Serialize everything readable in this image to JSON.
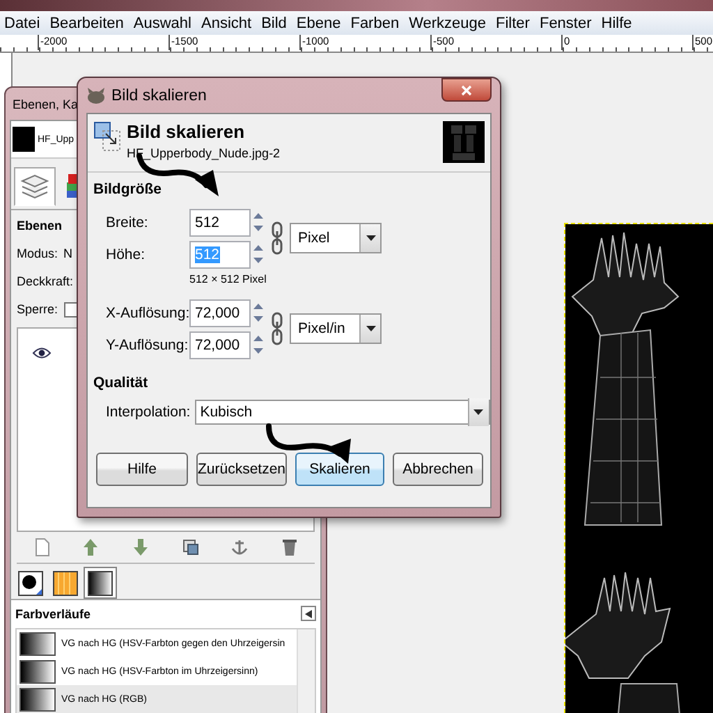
{
  "image_window": {
    "menu": [
      "Datei",
      "Bearbeiten",
      "Auswahl",
      "Ansicht",
      "Bild",
      "Ebene",
      "Farben",
      "Werkzeuge",
      "Filter",
      "Fenster",
      "Hilfe"
    ],
    "ruler_labels": [
      "-2000",
      "-1500",
      "-1000",
      "-500",
      "0",
      "500"
    ]
  },
  "dock": {
    "title": "Ebenen, Ka",
    "image": {
      "name": "HF_Upp"
    },
    "tabs": [
      {
        "kind": "layers",
        "selected": true
      },
      {
        "kind": "channels",
        "selected": false
      }
    ],
    "layers": {
      "title": "Ebenen",
      "mode_label": "Modus:",
      "mode_value": "N",
      "opacity_label": "Deckkraft:",
      "lock_label": "Sperre:",
      "lock_checked": false,
      "items": [
        {
          "visible": true
        }
      ]
    },
    "buttons": [
      {
        "kind": "new"
      },
      {
        "kind": "raise"
      },
      {
        "kind": "lower"
      },
      {
        "kind": "duplicate"
      },
      {
        "kind": "anchor"
      },
      {
        "kind": "delete"
      }
    ],
    "resource_tabs": [
      {
        "kind": "brushes",
        "selected": false
      },
      {
        "kind": "patterns",
        "selected": false
      },
      {
        "kind": "gradients",
        "selected": true
      }
    ],
    "gradients": {
      "title": "Farbverläufe",
      "items": [
        {
          "name": "VG nach HG (HSV-Farbton gegen den Uhrzeigersin",
          "selected": false
        },
        {
          "name": "VG nach HG (HSV-Farbton im Uhrzeigersinn)",
          "selected": false
        },
        {
          "name": "VG nach HG (RGB)",
          "selected": true
        }
      ]
    }
  },
  "dialog": {
    "title": "Bild skalieren",
    "heading": "Bild skalieren",
    "subtitle": "HF_Upperbody_Nude.jpg-2",
    "size": {
      "title": "Bildgröße",
      "fields": [
        {
          "label": "Breite:",
          "value": "512",
          "selected": false
        },
        {
          "label": "Höhe:",
          "value": "512",
          "selected": true
        }
      ],
      "unit": "Pixel",
      "summary": "512 × 512 Pixel"
    },
    "resolution": {
      "fields": [
        {
          "label": "X-Auflösung:",
          "value": "72,000",
          "selected": false
        },
        {
          "label": "Y-Auflösung:",
          "value": "72,000",
          "selected": false
        }
      ],
      "unit": "Pixel/in"
    },
    "quality": {
      "title": "Qualität",
      "label": "Interpolation:",
      "value": "Kubisch"
    },
    "buttons": [
      {
        "label": "Hilfe",
        "default": false
      },
      {
        "label": "Zurücksetzen",
        "default": false
      },
      {
        "label": "Skalieren",
        "default": true
      },
      {
        "label": "Abbrechen",
        "default": false
      }
    ]
  }
}
